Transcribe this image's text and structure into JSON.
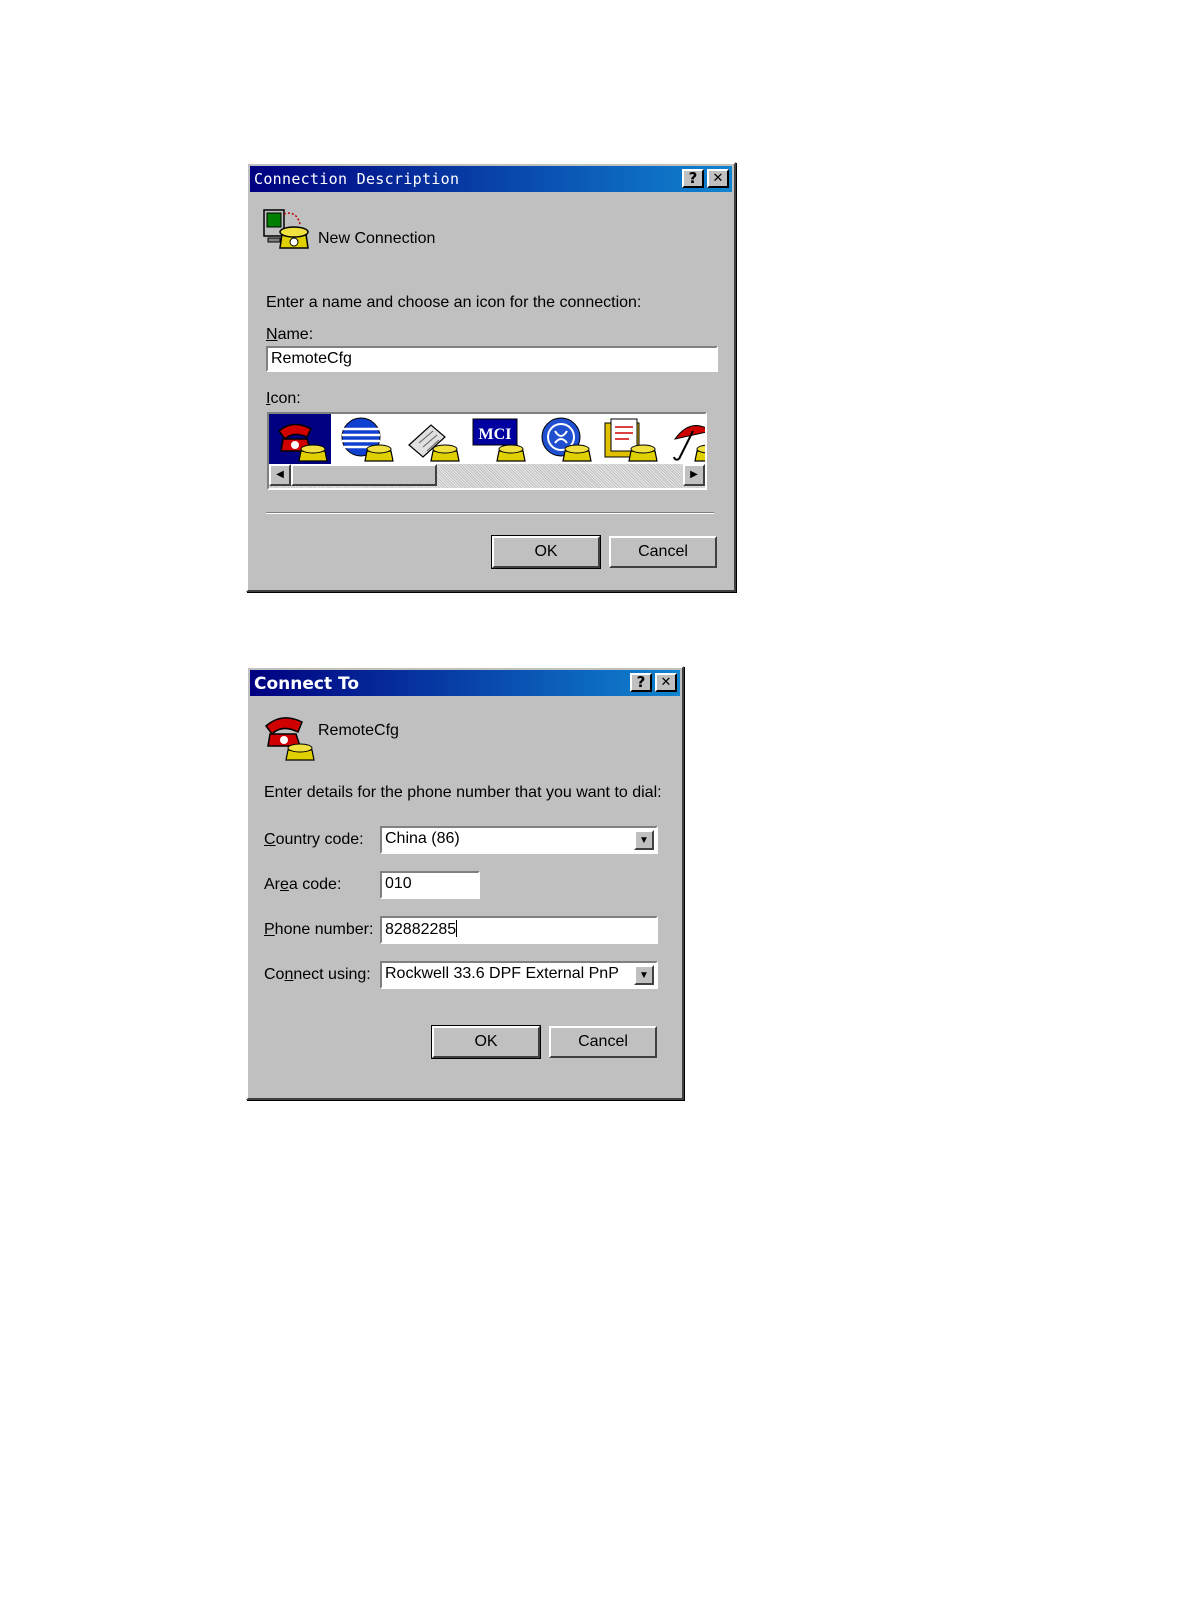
{
  "connection_description": {
    "title": "Connection Description",
    "help_label": "?",
    "close_label": "✕",
    "heading": "New Connection",
    "instruction": "Enter a name and choose an icon for the connection:",
    "name_label": "Name:",
    "name_value": "RemoteCfg",
    "icon_label": "Icon:",
    "icons": [
      "red-phone-icon",
      "globe-phone-icon",
      "fax-phone-icon",
      "mci-phone-icon",
      "ge-phone-icon",
      "folder-phone-icon",
      "umbrella-phone-icon"
    ],
    "mci_text": "MCI",
    "ok_label": "OK",
    "cancel_label": "Cancel"
  },
  "connect_to": {
    "title": "Connect To",
    "help_label": "?",
    "close_label": "✕",
    "heading": "RemoteCfg",
    "instruction": "Enter details for the phone number that you want to dial:",
    "country_code_label": "Country code:",
    "country_code_value": "China (86)",
    "area_code_label": "Area code:",
    "area_code_value": "010",
    "phone_number_label": "Phone number:",
    "phone_number_value": "82882285",
    "connect_using_label": "Connect using:",
    "connect_using_value": "Rockwell 33.6 DPF External PnP",
    "ok_label": "OK",
    "cancel_label": "Cancel"
  },
  "colors": {
    "titlebar_start": "#000080",
    "titlebar_end": "#1084d0",
    "dialog_face": "#c0c0c0",
    "selected_icon_bg": "#000080"
  }
}
